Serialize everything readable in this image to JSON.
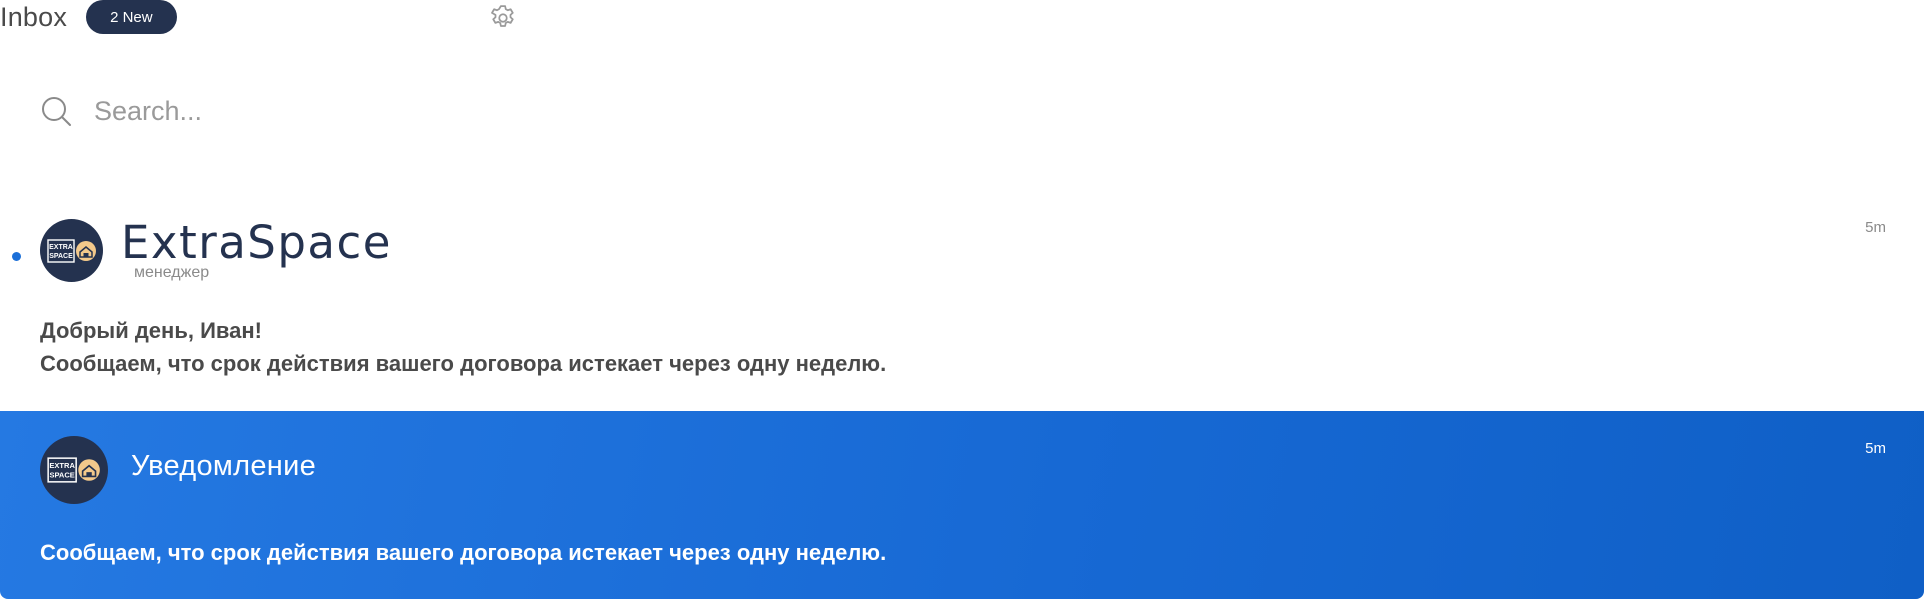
{
  "header": {
    "title": "Inbox",
    "badge": "2 New",
    "settings_icon": "gear-icon"
  },
  "search": {
    "placeholder": "Search...",
    "value": "",
    "icon": "search-icon"
  },
  "messages": [
    {
      "sender_logo_text": "ExtraSpace",
      "sender_role": "менеджер",
      "time": "5m",
      "unread": true,
      "lines": [
        "Добрый день, Иван!",
        "Сообщаем, что срок действия вашего договора истекает через одну неделю."
      ],
      "avatar_text": [
        "EXTRA",
        "SPACE"
      ]
    },
    {
      "title": "Уведомление",
      "time": "5m",
      "selected": true,
      "lines": [
        "Сообщаем, что срок действия вашего договора истекает через одну неделю."
      ],
      "avatar_text": [
        "EXTRA",
        "SPACE"
      ]
    }
  ],
  "colors": {
    "badge_bg": "#24324f",
    "unread_dot": "#1b6fd8",
    "selected_bg": "#1769d4",
    "avatar_bg": "#24324f",
    "avatar_accent": "#f3c98b"
  }
}
